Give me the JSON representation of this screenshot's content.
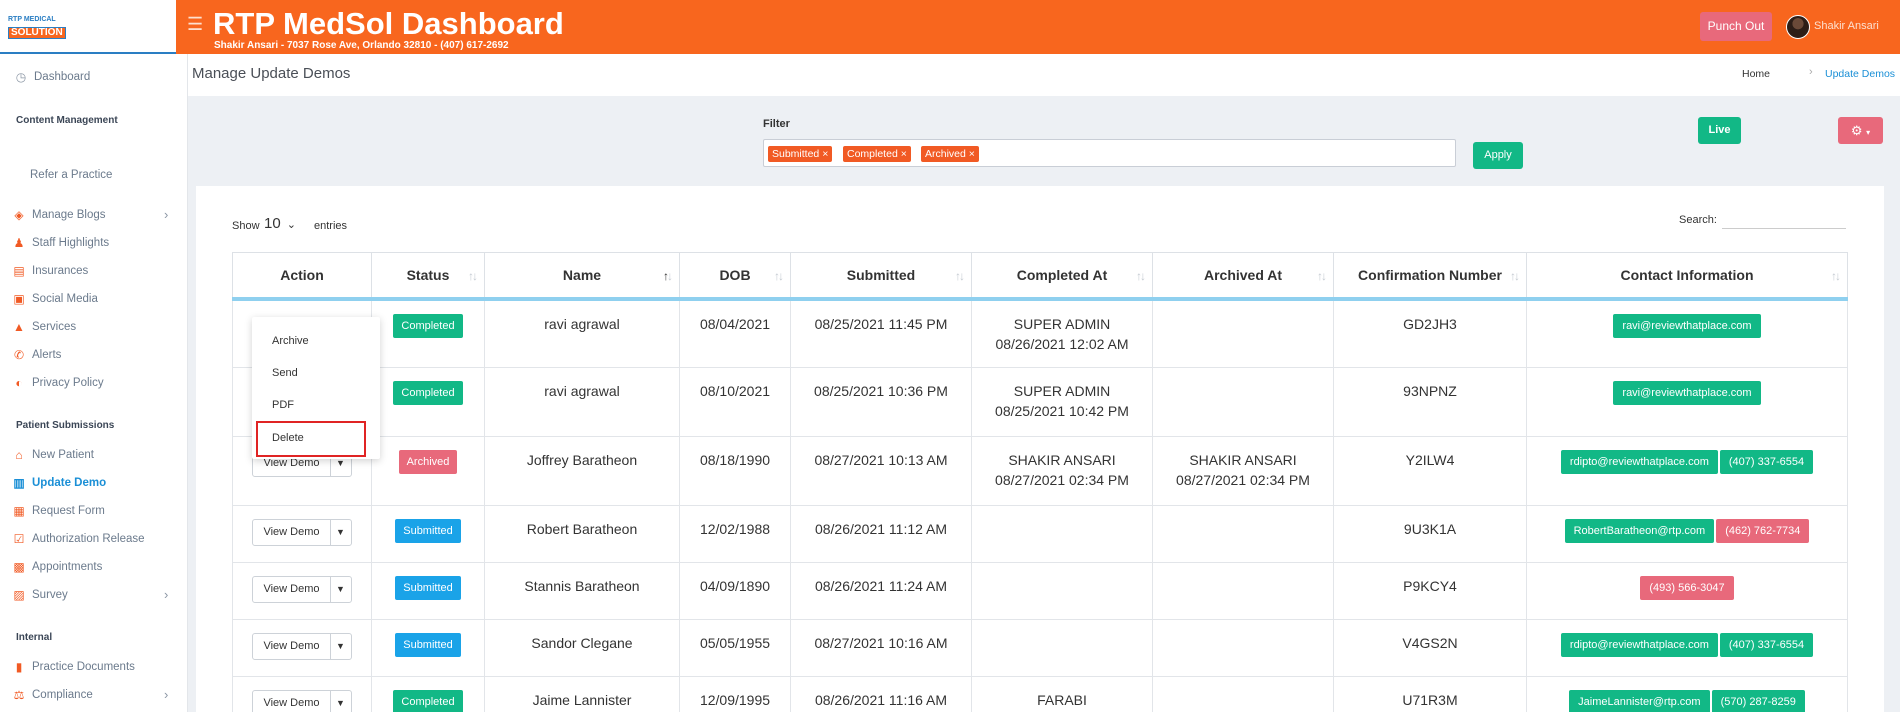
{
  "header": {
    "logo_line1": "RTP MEDICAL",
    "logo_line2": "SOLUTION",
    "title": "RTP MedSol Dashboard",
    "subtitle": "Shakir Ansari - 7037 Rose Ave, Orlando 32810 - (407) 617-2692",
    "punch_out": "Punch Out",
    "user_name": "Shakir Ansari"
  },
  "sidebar": {
    "dashboard": "Dashboard",
    "content_management": "Content Management",
    "refer": "Refer a Practice",
    "items_content": [
      "Manage Blogs",
      "Staff Highlights",
      "Insurances",
      "Social Media",
      "Services",
      "Alerts",
      "Privacy Policy"
    ],
    "patient_submissions": "Patient Submissions",
    "items_patient": [
      "New Patient",
      "Update Demo",
      "Request Form",
      "Authorization Release",
      "Appointments",
      "Survey"
    ],
    "internal": "Internal",
    "items_internal": [
      "Practice Documents",
      "Compliance"
    ]
  },
  "page": {
    "title": "Manage Update Demos",
    "crumb_home": "Home",
    "crumb_current": "Update Demos"
  },
  "filter": {
    "label": "Filter",
    "tags": [
      "Submitted",
      "Completed",
      "Archived"
    ],
    "apply": "Apply",
    "live": "Live"
  },
  "table_controls": {
    "show": "Show",
    "entries_value": "10",
    "entries": "entries",
    "search": "Search:"
  },
  "columns": [
    "Action",
    "Status",
    "Name",
    "DOB",
    "Submitted",
    "Completed At",
    "Archived At",
    "Confirmation Number",
    "Contact Information"
  ],
  "rows": [
    {
      "status": "Completed",
      "name": "ravi agrawal",
      "dob": "08/04/2021",
      "submitted": "08/25/2021 11:45 PM",
      "completed_by": "SUPER ADMIN",
      "completed_at": "08/26/2021 12:02 AM",
      "archived_by": "",
      "archived_at": "",
      "conf": "GD2JH3",
      "email": "ravi@reviewthatplace.com",
      "phone": ""
    },
    {
      "status": "Completed",
      "name": "ravi agrawal",
      "dob": "08/10/2021",
      "submitted": "08/25/2021 10:36 PM",
      "completed_by": "SUPER ADMIN",
      "completed_at": "08/25/2021 10:42 PM",
      "archived_by": "",
      "archived_at": "",
      "conf": "93NPNZ",
      "email": "ravi@reviewthatplace.com",
      "phone": ""
    },
    {
      "status": "Archived",
      "name": "Joffrey Baratheon",
      "dob": "08/18/1990",
      "submitted": "08/27/2021 10:13 AM",
      "completed_by": "SHAKIR ANSARI",
      "completed_at": "08/27/2021 02:34 PM",
      "archived_by": "SHAKIR ANSARI",
      "archived_at": "08/27/2021 02:34 PM",
      "conf": "Y2ILW4",
      "email": "rdipto@reviewthatplace.com",
      "phone": "(407) 337-6554"
    },
    {
      "status": "Submitted",
      "name": "Robert Baratheon",
      "dob": "12/02/1988",
      "submitted": "08/26/2021 11:12 AM",
      "completed_by": "",
      "completed_at": "",
      "archived_by": "",
      "archived_at": "",
      "conf": "9U3K1A",
      "email": "RobertBaratheon@rtp.com",
      "phone": "(462) 762-7734"
    },
    {
      "status": "Submitted",
      "name": "Stannis Baratheon",
      "dob": "04/09/1890",
      "submitted": "08/26/2021 11:24 AM",
      "completed_by": "",
      "completed_at": "",
      "archived_by": "",
      "archived_at": "",
      "conf": "P9KCY4",
      "email": "",
      "phone": "(493) 566-3047"
    },
    {
      "status": "Submitted",
      "name": "Sandor Clegane",
      "dob": "05/05/1955",
      "submitted": "08/27/2021 10:16 AM",
      "completed_by": "",
      "completed_at": "",
      "archived_by": "",
      "archived_at": "",
      "conf": "V4GS2N",
      "email": "rdipto@reviewthatplace.com",
      "phone": "(407) 337-6554"
    },
    {
      "status": "Completed",
      "name": "Jaime Lannister",
      "dob": "12/09/1995",
      "submitted": "08/26/2021 11:16 AM",
      "completed_by": "FARABI",
      "completed_at": "",
      "archived_by": "",
      "archived_at": "",
      "conf": "U71R3M",
      "email": "JaimeLannister@rtp.com",
      "phone": "(570) 287-8259"
    }
  ],
  "action": {
    "view_demo": "View Demo",
    "menu": [
      "Archive",
      "Send",
      "PDF",
      "Delete"
    ]
  },
  "colors": {
    "brand": "#f8661e",
    "green": "#12b886",
    "red": "#e8697b",
    "blue": "#1aa3e8"
  }
}
